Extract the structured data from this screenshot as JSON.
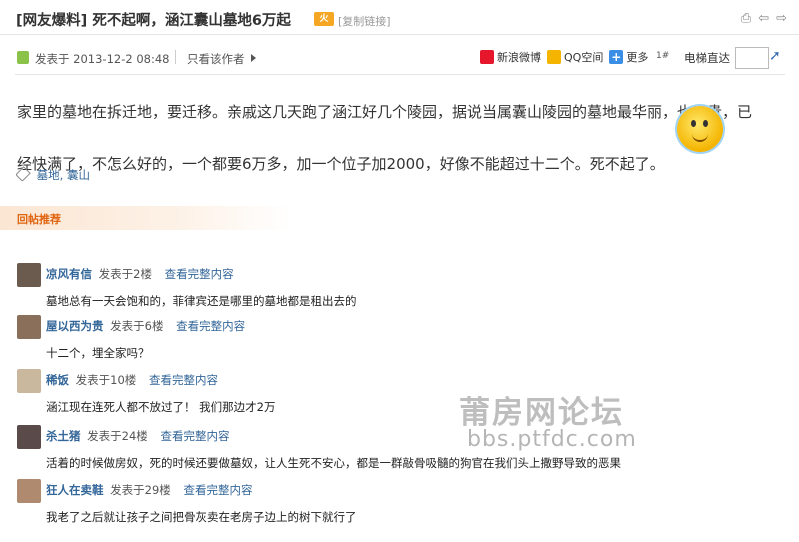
{
  "thread": {
    "category": "[网友爆料]",
    "title": "死不起啊，涵江囊山墓地6万起",
    "hot_badge": "火",
    "copy_link": "[复制链接]"
  },
  "meta": {
    "posted_at": "发表于 2013-12-2 08:48",
    "only_author": "只看该作者",
    "share": [
      {
        "label": "新浪微博",
        "icon": "weibo-icon",
        "color": "#e6162d"
      },
      {
        "label": "QQ空间",
        "icon": "qzone-icon",
        "color": "#f5b400"
      },
      {
        "label": "更多",
        "icon": "plus-icon",
        "color": "#3a8ee6"
      }
    ],
    "floor": "1#",
    "elevator_label": "电梯直达",
    "elevator_value": ""
  },
  "post": {
    "line1": "家里的墓地在拆迁地，要迁移。亲戚这几天跑了涵江好几个陵园，据说当属囊山陵园的墓地最华丽，也最贵，已",
    "line2": "经快满了，不怎么好的，一个都要6万多，加一个位子加2000，好像不能超过十二个。死不起了。",
    "tags": [
      "墓地",
      "囊山"
    ]
  },
  "replies_title": "回帖推荐",
  "replies": [
    {
      "user": "凉风有信",
      "floor": "发表于2楼",
      "view": "查看完整内容",
      "text": "墓地总有一天会饱和的，菲律宾还是哪里的墓地都是租出去的",
      "avatar_color": "#6b5b4e"
    },
    {
      "user": "屋以西为贵",
      "floor": "发表于6楼",
      "view": "查看完整内容",
      "text": "十二个，埋全家吗？",
      "avatar_color": "#8a6f5a"
    },
    {
      "user": "稀饭",
      "floor": "发表于10楼",
      "view": "查看完整内容",
      "text": "涵江现在连死人都不放过了！ 我们那边才2万",
      "avatar_color": "#c9b89e"
    },
    {
      "user": "杀土猪",
      "floor": "发表于24楼",
      "view": "查看完整内容",
      "text": "活着的时候做房奴，死的时候还要做墓奴，让人生死不安心，都是一群敲骨吸髓的狗官在我们头上撒野导致的恶果",
      "avatar_color": "#5a4a4a"
    },
    {
      "user": "狂人在卖鞋",
      "floor": "发表于29楼",
      "view": "查看完整内容",
      "text": "我老了之后就让孩子之间把骨灰卖在老房子边上的树下就行了",
      "avatar_color": "#b08a6e"
    }
  ],
  "watermark": {
    "line1": "莆房网论坛",
    "line2": "bbs.ptfdc.com"
  }
}
